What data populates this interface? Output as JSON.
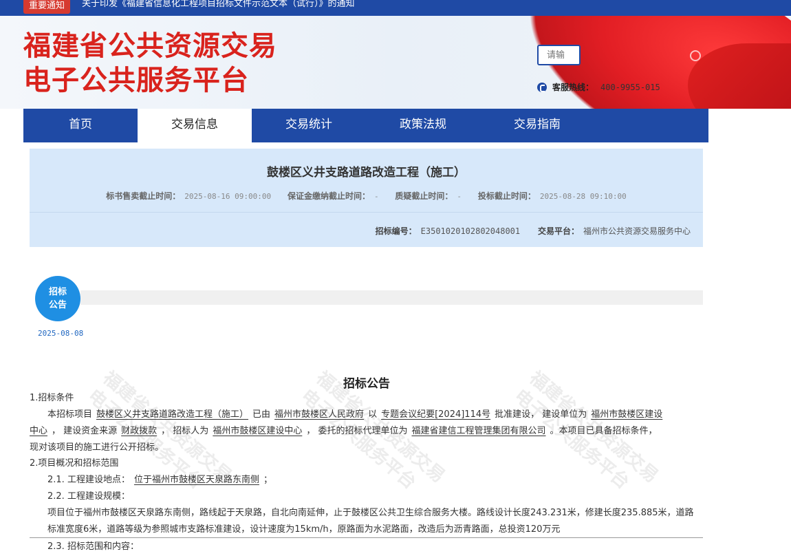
{
  "notice": {
    "badge": "重要通知",
    "text": "关于印发《福建省信息化工程项目招标文件示范文本（试行）》的通知"
  },
  "header": {
    "logo_line1": "福建省公共资源交易",
    "logo_line2": "电子公共服务平台",
    "search_placeholder": "请输",
    "hotline_label": "客服热线：",
    "hotline_number": "400-9955-015"
  },
  "nav": {
    "items": [
      {
        "label": "首页"
      },
      {
        "label": "交易信息",
        "active": true
      },
      {
        "label": "交易统计"
      },
      {
        "label": "政策法规"
      },
      {
        "label": "交易指南"
      }
    ]
  },
  "project": {
    "title": "鼓楼区义井支路道路改造工程（施工）",
    "doc_sale_deadline_label": "标书售卖截止时间：",
    "doc_sale_deadline": "2025-08-16 09:00:00",
    "deposit_deadline_label": "保证金缴纳截止时间：",
    "deposit_deadline": "-",
    "query_deadline_label": "质疑截止时间：",
    "query_deadline": "-",
    "bid_deadline_label": "投标截止时间：",
    "bid_deadline": "2025-08-28 09:10:00",
    "bid_no_label": "招标编号：",
    "bid_no": "E3501020102802048001",
    "platform_label": "交易平台：",
    "platform": "福州市公共资源交易服务中心"
  },
  "timeline": {
    "node_line1": "招标",
    "node_line2": "公告",
    "date": "2025-08-08"
  },
  "article": {
    "title": "招标公告",
    "watermark_line1": "福建省公共资源交易",
    "watermark_line2": "电子公共服务平台",
    "s1": "1.招标条件",
    "p1_a": "本招标项目",
    "p1_project": "鼓楼区义井支路道路改造工程（施工）",
    "p1_b": "已由",
    "p1_approver": "福州市鼓楼区人民政府",
    "p1_c": "以",
    "p1_doc": "专题会议纪要[2024]114号",
    "p1_d": "批准建设，  建设单位为",
    "p1_owner_1": "福州市鼓楼区建设",
    "p1_owner_2": "中心",
    "p1_e": "，  建设资金来源",
    "p1_fund": "财政拨款",
    "p1_f": "，  招标人为",
    "p1_tenderer": "福州市鼓楼区建设中心",
    "p1_g": "，  委托的招标代理单位为",
    "p1_agent": "福建省建信工程管理集团有限公司",
    "p1_h": "。本项目已具备招标条件，",
    "p1_i": "现对该项目的施工进行公开招标。",
    "s2": "2.项目概况和招标范围",
    "s21_label": "2.1.    工程建设地点：",
    "s21_value": "位于福州市鼓楼区天泉路东南侧",
    "s21_end": "；",
    "s22_label": "2.2.    工程建设规模：",
    "s22_text1": "项目位于福州市鼓楼区天泉路东南侧，路线起于天泉路，自北向南延伸，止于鼓楼区公共卫生综合服务大楼。路线设计长度243.231米，修建长度235.885米，道路",
    "s22_text2": "标准宽度6米，道路等级为参照城市支路标准建设，设计速度为15km/h，原路面为水泥路面，改造后为沥青路面，总投资120万元",
    "s23_label": "2.3.    招标范围和内容："
  }
}
